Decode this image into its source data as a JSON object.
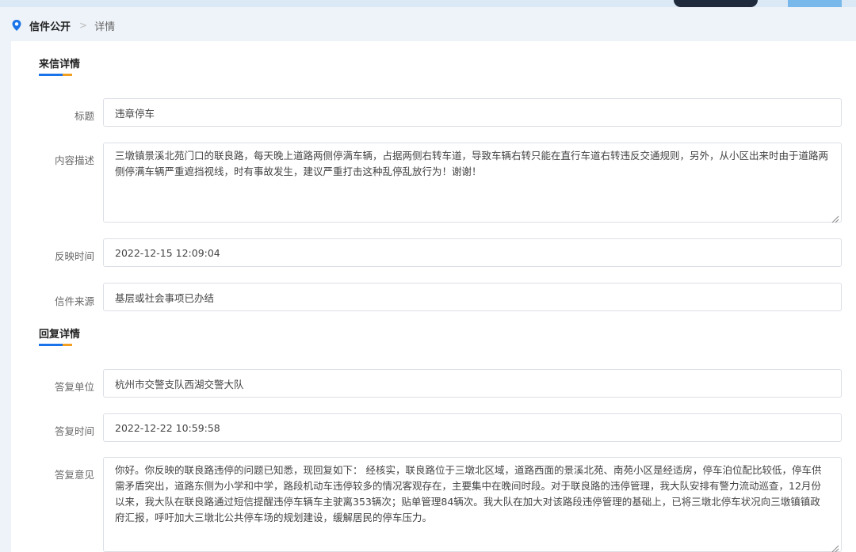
{
  "breadcrumb": {
    "home": "信件公开",
    "separator": ">",
    "current": "详情"
  },
  "letter_section": {
    "title": "来信详情",
    "fields": {
      "title_label": "标题",
      "title_value": "违章停车",
      "content_label": "内容描述",
      "content_value": "三墩镇景溪北苑门口的联良路，每天晚上道路两侧停满车辆，占据两侧右转车道，导致车辆右转只能在直行车道右转违反交通规则，另外，从小区出来时由于道路两侧停满车辆严重遮挡视线，时有事故发生，建议严重打击这种乱停乱放行为！谢谢！",
      "time_label": "反映时间",
      "time_value": "2022-12-15 12:09:04",
      "source_label": "信件来源",
      "source_value": "基层或社会事项已办结"
    }
  },
  "reply_section": {
    "title": "回复详情",
    "fields": {
      "unit_label": "答复单位",
      "unit_value": "杭州市交警支队西湖交警大队",
      "time_label": "答复时间",
      "time_value": "2022-12-22 10:59:58",
      "opinion_label": "答复意见",
      "opinion_value": "你好。你反映的联良路违停的问题已知悉，现回复如下： 经核实，联良路位于三墩北区域，道路西面的景溪北苑、南苑小区是经适房，停车泊位配比较低，停车供需矛盾突出，道路东侧为小学和中学，路段机动车违停较多的情况客观存在，主要集中在晚间时段。对于联良路的违停管理，我大队安排有警力流动巡查，12月份以来，我大队在联良路通过短信提醒违停车辆车主驶离353辆次；贴单管理84辆次。我大队在加大对该路段违停管理的基础上，已将三墩北停车状况向三墩镇镇政府汇报，呼吁加大三墩北公共停车场的规划建设，缓解居民的停车压力。"
    }
  },
  "colors": {
    "accent": "#1a73e8",
    "accent_secondary": "#f2a022",
    "background": "#eef3f9"
  },
  "icons": {
    "breadcrumb": "location-pin-icon",
    "resize": "resize-grip-icon"
  }
}
